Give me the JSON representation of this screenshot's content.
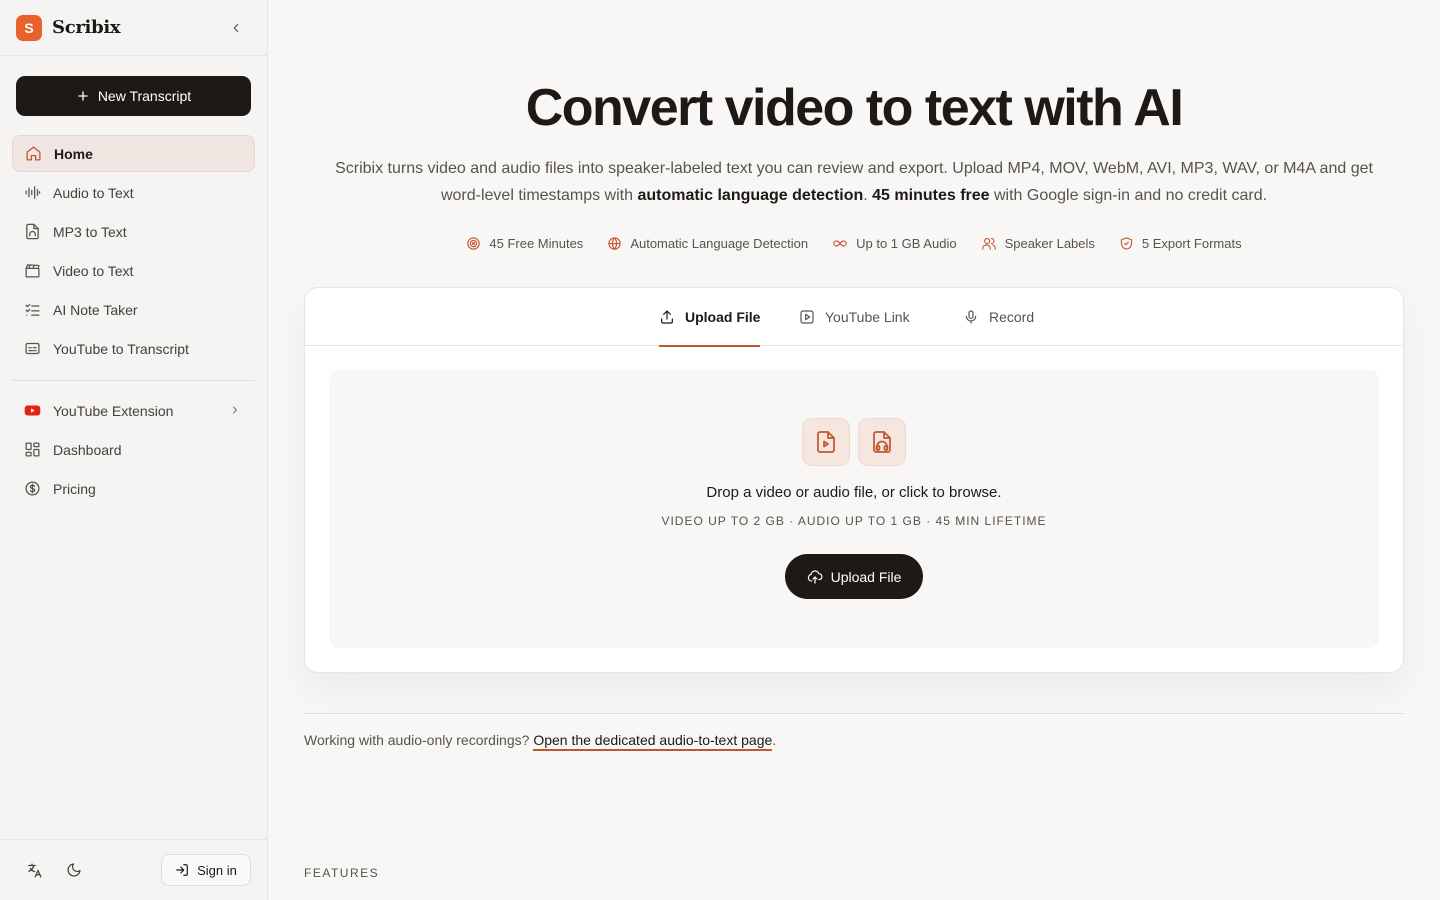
{
  "sidebar": {
    "brand": {
      "logo_letter": "S",
      "name": "Scribix"
    },
    "new_button": "New Transcript",
    "items": [
      {
        "label": "Home",
        "icon": "home-icon",
        "active": true
      },
      {
        "label": "Audio to Text",
        "icon": "waveform-icon"
      },
      {
        "label": "MP3 to Text",
        "icon": "audio-file-icon"
      },
      {
        "label": "Video to Text",
        "icon": "clapperboard-icon"
      },
      {
        "label": "AI Note Taker",
        "icon": "checklist-icon"
      },
      {
        "label": "YouTube to Transcript",
        "icon": "captions-icon"
      }
    ],
    "secondary_items": [
      {
        "label": "YouTube Extension",
        "icon": "youtube-icon"
      },
      {
        "label": "Dashboard",
        "icon": "dashboard-icon"
      },
      {
        "label": "Pricing",
        "icon": "dollar-circle-icon"
      }
    ],
    "sign_in": "Sign in"
  },
  "hero": {
    "title": "Convert video to text with AI",
    "subtitle_part1": "Scribix turns video and audio files into speaker-labeled text you can review and export. Upload MP4, MOV, WebM, AVI, MP3, WAV, or M4A and get word-level timestamps with ",
    "subtitle_bold1": "automatic language detection",
    "subtitle_part2": ". ",
    "subtitle_bold2": "45 minutes free",
    "subtitle_part3": " with Google sign-in and no credit card."
  },
  "features": [
    {
      "label": "45 Free Minutes",
      "icon": "target-icon"
    },
    {
      "label": "Automatic Language Detection",
      "icon": "globe-icon"
    },
    {
      "label": "Up to 1 GB Audio",
      "icon": "infinity-icon"
    },
    {
      "label": "Speaker Labels",
      "icon": "users-icon"
    },
    {
      "label": "5 Export Formats",
      "icon": "shield-check-icon"
    }
  ],
  "tabs": [
    {
      "label": "Upload File",
      "icon": "upload-icon",
      "active": true
    },
    {
      "label": "YouTube Link",
      "icon": "play-square-icon"
    },
    {
      "label": "Record",
      "icon": "microphone-icon"
    }
  ],
  "dropzone": {
    "text": "Drop a video or audio file, or click to browse.",
    "meta": "VIDEO UP TO 2 GB · AUDIO UP TO 1 GB · 45 MIN LIFETIME",
    "button": "Upload File"
  },
  "audio_note": {
    "prefix": "Working with audio-only recordings? ",
    "link": "Open the dedicated audio-to-text page",
    "suffix": "."
  },
  "section_label": "FEATURES",
  "colors": {
    "accent": "#c2552e",
    "brand": "#e8622c",
    "dark": "#1c1917",
    "youtube": "#e62117"
  }
}
